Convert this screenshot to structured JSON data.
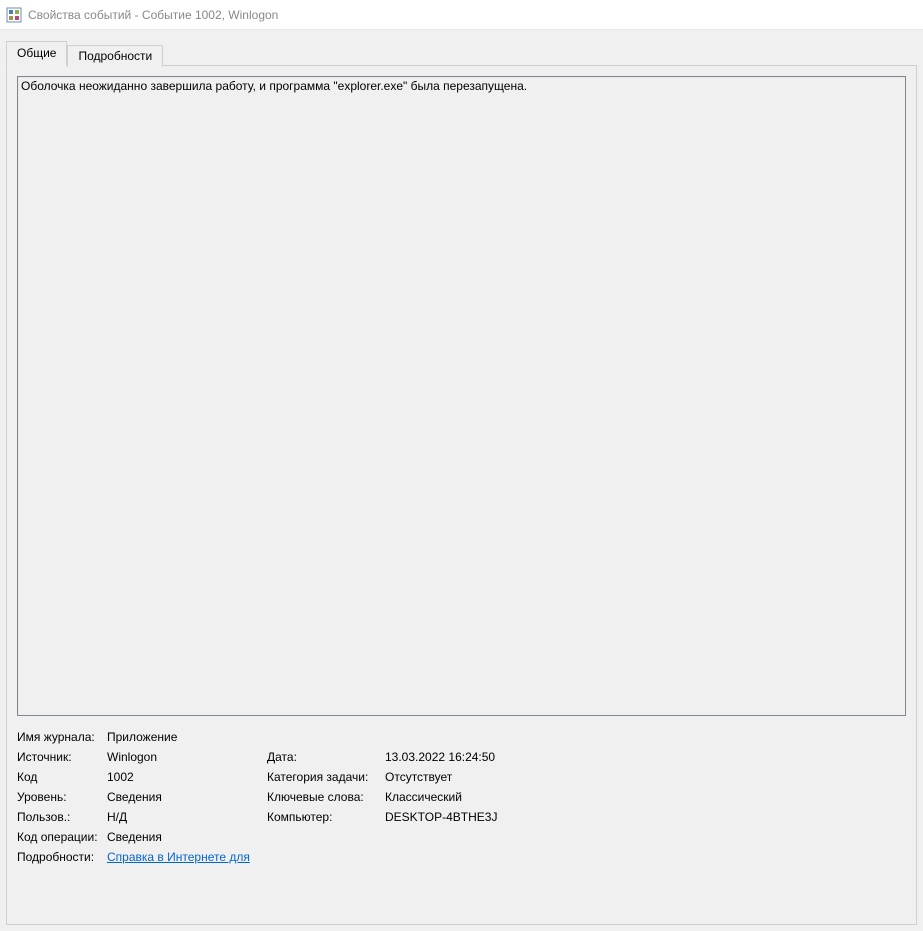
{
  "window": {
    "title": "Свойства событий - Событие 1002, Winlogon"
  },
  "tabs": {
    "general": "Общие",
    "details": "Подробности"
  },
  "description": "Оболочка неожиданно завершила работу, и программа \"explorer.exe\" была перезапущена.",
  "labels": {
    "log_name": "Имя журнала:",
    "source": "Источник:",
    "event_id": "Код",
    "level": "Уровень:",
    "user": "Пользов.:",
    "opcode": "Код операции:",
    "more_info": "Подробности:",
    "date": "Дата:",
    "task_category": "Категория задачи:",
    "keywords": "Ключевые слова:",
    "computer": "Компьютер:"
  },
  "values": {
    "log_name": "Приложение",
    "source": "Winlogon",
    "event_id": "1002",
    "level": "Сведения",
    "user": "Н/Д",
    "opcode": "Сведения",
    "date": "13.03.2022 16:24:50",
    "task_category": "Отсутствует",
    "keywords": "Классический",
    "computer": "DESKTOP-4BTHE3J",
    "help_link": "Справка в Интернете для "
  }
}
